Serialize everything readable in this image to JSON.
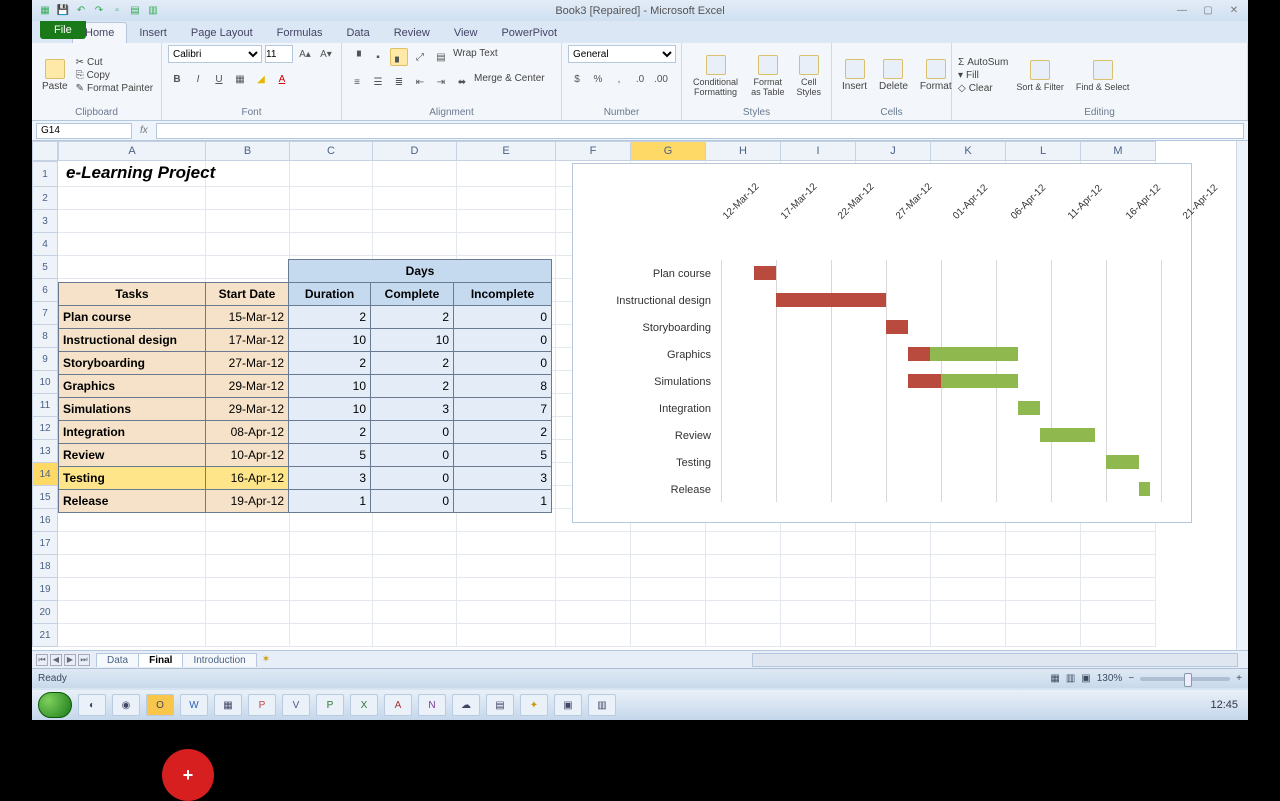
{
  "app": {
    "title": "Book3 [Repaired] - Microsoft Excel"
  },
  "ribbon": {
    "file": "File",
    "tabs": [
      "Home",
      "Insert",
      "Page Layout",
      "Formulas",
      "Data",
      "Review",
      "View",
      "PowerPivot"
    ],
    "active": "Home",
    "clipboard": {
      "paste": "Paste",
      "cut": "Cut",
      "copy": "Copy",
      "painter": "Format Painter",
      "label": "Clipboard"
    },
    "font": {
      "name": "Calibri",
      "size": "11",
      "label": "Font"
    },
    "alignment": {
      "wrap": "Wrap Text",
      "merge": "Merge & Center",
      "label": "Alignment"
    },
    "number": {
      "format": "General",
      "label": "Number"
    },
    "styles": {
      "cond": "Conditional Formatting",
      "table": "Format as Table",
      "cell": "Cell Styles",
      "label": "Styles"
    },
    "cells": {
      "insert": "Insert",
      "delete": "Delete",
      "format": "Format",
      "label": "Cells"
    },
    "editing": {
      "sum": "AutoSum",
      "fill": "Fill",
      "clear": "Clear",
      "sort": "Sort & Filter",
      "find": "Find & Select",
      "label": "Editing"
    }
  },
  "namebox": "G14",
  "columns": [
    "A",
    "B",
    "C",
    "D",
    "E",
    "F",
    "G",
    "H",
    "I",
    "J",
    "K",
    "L",
    "M"
  ],
  "rows": [
    "1",
    "2",
    "3",
    "4",
    "5",
    "6",
    "7",
    "8",
    "9",
    "10",
    "11",
    "12",
    "13",
    "14",
    "15",
    "16",
    "17",
    "18",
    "19",
    "20",
    "21"
  ],
  "worksheet_title": "e-Learning Project",
  "table": {
    "days_label": "Days",
    "headers": {
      "tasks": "Tasks",
      "start": "Start Date",
      "dur": "Duration",
      "comp": "Complete",
      "inc": "Incomplete"
    },
    "rows": [
      {
        "task": "Plan course",
        "date": "15-Mar-12",
        "dur": "2",
        "comp": "2",
        "inc": "0"
      },
      {
        "task": "Instructional design",
        "date": "17-Mar-12",
        "dur": "10",
        "comp": "10",
        "inc": "0"
      },
      {
        "task": "Storyboarding",
        "date": "27-Mar-12",
        "dur": "2",
        "comp": "2",
        "inc": "0"
      },
      {
        "task": "Graphics",
        "date": "29-Mar-12",
        "dur": "10",
        "comp": "2",
        "inc": "8"
      },
      {
        "task": "Simulations",
        "date": "29-Mar-12",
        "dur": "10",
        "comp": "3",
        "inc": "7"
      },
      {
        "task": "Integration",
        "date": "08-Apr-12",
        "dur": "2",
        "comp": "0",
        "inc": "2"
      },
      {
        "task": "Review",
        "date": "10-Apr-12",
        "dur": "5",
        "comp": "0",
        "inc": "5"
      },
      {
        "task": "Testing",
        "date": "16-Apr-12",
        "dur": "3",
        "comp": "0",
        "inc": "3"
      },
      {
        "task": "Release",
        "date": "19-Apr-12",
        "dur": "1",
        "comp": "0",
        "inc": "1"
      }
    ]
  },
  "chart_data": {
    "type": "bar",
    "x_ticks": [
      "12-Mar-12",
      "17-Mar-12",
      "22-Mar-12",
      "27-Mar-12",
      "01-Apr-12",
      "06-Apr-12",
      "11-Apr-12",
      "16-Apr-12",
      "21-Apr-12"
    ],
    "categories": [
      "Plan course",
      "Instructional design",
      "Storyboarding",
      "Graphics",
      "Simulations",
      "Integration",
      "Review",
      "Testing",
      "Release"
    ],
    "series": [
      {
        "name": "Start",
        "role": "offset",
        "values": [
          "15-Mar-12",
          "17-Mar-12",
          "27-Mar-12",
          "29-Mar-12",
          "29-Mar-12",
          "08-Apr-12",
          "10-Apr-12",
          "16-Apr-12",
          "19-Apr-12"
        ]
      },
      {
        "name": "Complete",
        "color": "#b84b3d",
        "values": [
          2,
          10,
          2,
          2,
          3,
          0,
          0,
          0,
          0
        ]
      },
      {
        "name": "Incomplete",
        "color": "#8fb94f",
        "values": [
          0,
          0,
          0,
          8,
          7,
          2,
          5,
          3,
          1
        ]
      }
    ]
  },
  "sheet_tabs": [
    "Data",
    "Final",
    "Introduction"
  ],
  "active_sheet": "Final",
  "status": {
    "ready": "Ready",
    "zoom": "130%"
  },
  "clock": "12:45",
  "selected_row": "14"
}
